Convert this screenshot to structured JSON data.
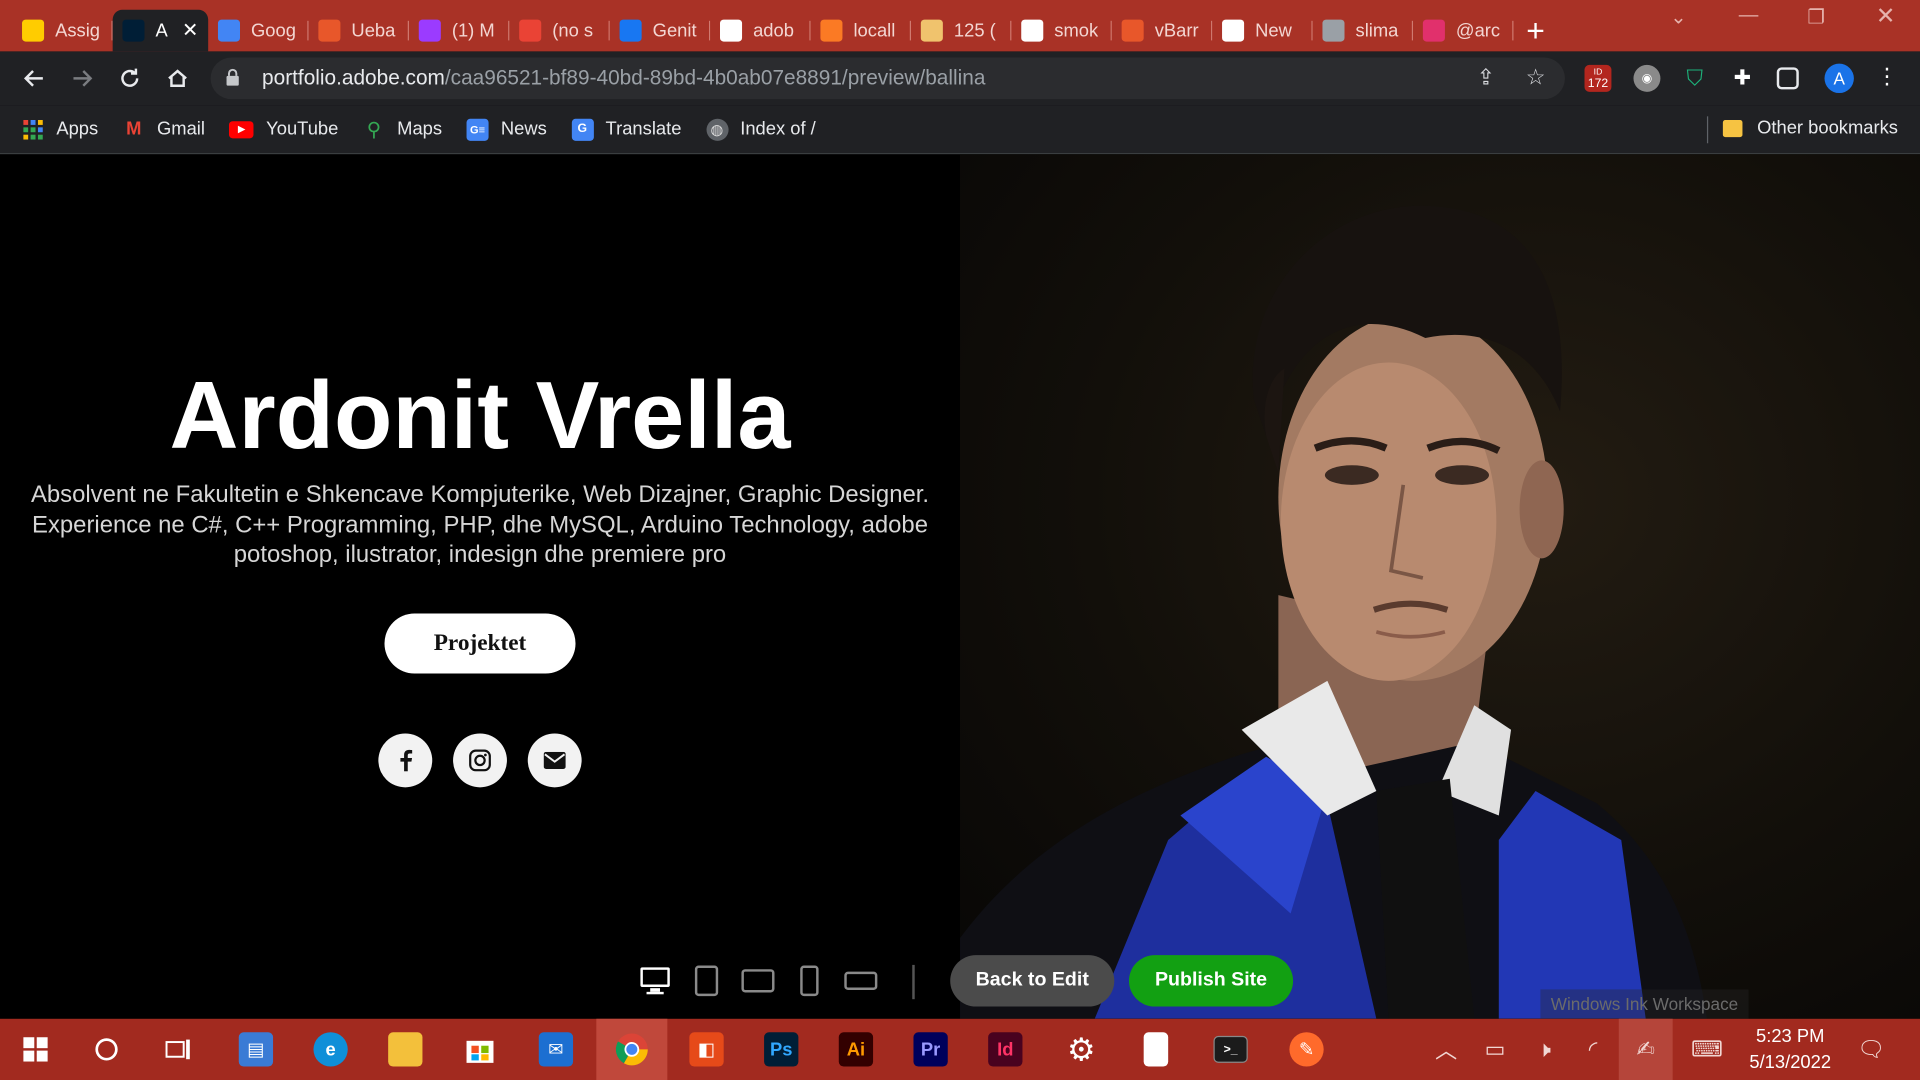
{
  "browser": {
    "tabs": [
      {
        "title": "Assig",
        "icon": "monday-icon",
        "color": "#ffcc00"
      },
      {
        "title": "A",
        "icon": "portfolio-icon",
        "color": "#001e36",
        "active": true
      },
      {
        "title": "Goog",
        "icon": "translate-icon",
        "color": "#4285f4"
      },
      {
        "title": "Ueba",
        "icon": "brackets-icon",
        "color": "#e8572a"
      },
      {
        "title": "(1) M",
        "icon": "messenger-icon",
        "color": "#9b3bff"
      },
      {
        "title": "(no s",
        "icon": "gmail-icon",
        "color": "#ea4335"
      },
      {
        "title": "Genit",
        "icon": "facebook-icon",
        "color": "#1877f2"
      },
      {
        "title": "adob",
        "icon": "google-icon",
        "color": "#ffffff"
      },
      {
        "title": "locall",
        "icon": "xampp-icon",
        "color": "#fb7a24"
      },
      {
        "title": "125 (",
        "icon": "page-icon",
        "color": "#f0c36d"
      },
      {
        "title": "smok",
        "icon": "google-icon",
        "color": "#ffffff"
      },
      {
        "title": "vBarr",
        "icon": "brackets-icon",
        "color": "#e8572a"
      },
      {
        "title": "New",
        "icon": "chrome-icon",
        "color": "#ffffff"
      },
      {
        "title": "slima",
        "icon": "globe-icon",
        "color": "#9aa0a6"
      },
      {
        "title": "@arc",
        "icon": "instagram-icon",
        "color": "#e1306c"
      }
    ],
    "url_host": "portfolio.adobe.com",
    "url_path": "/caa96521-bf89-40bd-89bd-4b0ab07e8891/preview/ballina",
    "ext_badge": "172",
    "profile_letter": "A",
    "bookmarks": [
      {
        "label": "Apps",
        "icon": "apps-grid-icon"
      },
      {
        "label": "Gmail",
        "icon": "gmail-icon"
      },
      {
        "label": "YouTube",
        "icon": "youtube-icon"
      },
      {
        "label": "Maps",
        "icon": "maps-icon"
      },
      {
        "label": "News",
        "icon": "news-icon"
      },
      {
        "label": "Translate",
        "icon": "translate-icon"
      },
      {
        "label": "Index of /",
        "icon": "globe-icon"
      }
    ],
    "other_bookmarks": "Other bookmarks"
  },
  "page": {
    "name": "Ardonit Vrella",
    "description": "Absolvent ne Fakultetin e Shkencave Kompjuterike, Web Dizajner, Graphic Designer. Experience ne C#, C++ Programming, PHP, dhe MySQL, Arduino Technology, adobe potoshop, ilustrator, indesign dhe premiere pro",
    "cta": "Projektet",
    "socials": [
      "facebook-icon",
      "instagram-icon",
      "mail-icon"
    ]
  },
  "preview_bar": {
    "devices": [
      "desktop-icon",
      "tablet-portrait-icon",
      "tablet-landscape-icon",
      "phone-portrait-icon",
      "phone-landscape-icon"
    ],
    "back_label": "Back to Edit",
    "publish_label": "Publish Site",
    "publish_color": "#12a012"
  },
  "watermark": "Windows Ink Workspace",
  "taskbar": {
    "apps": [
      "start-icon",
      "search-icon",
      "task-view-icon",
      "store-window-icon",
      "edge-icon",
      "file-explorer-icon",
      "microsoft-store-icon",
      "mail-icon",
      "chrome-icon",
      "office-icon",
      "photoshop-icon",
      "illustrator-icon",
      "premiere-icon",
      "indesign-icon",
      "settings-icon",
      "notepad-icon",
      "terminal-icon",
      "pen-icon"
    ],
    "app_labels": {
      "ps": "Ps",
      "ai": "Ai",
      "pr": "Pr",
      "id": "Id"
    },
    "time": "5:23 PM",
    "date": "5/13/2022"
  }
}
